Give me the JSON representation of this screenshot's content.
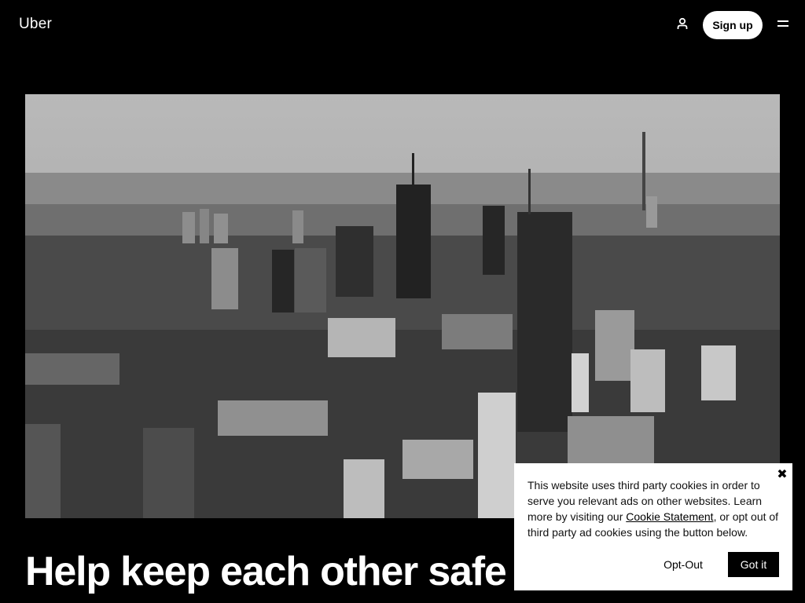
{
  "header": {
    "logo": "Uber",
    "user_icon": "person-icon",
    "signup_label": "Sign up",
    "menu_icon": "hamburger-menu-icon"
  },
  "hero": {
    "image": "black-and-white city skyline"
  },
  "main": {
    "headline": "Help keep each other safe"
  },
  "cookie_banner": {
    "text_before": "This website uses third party cookies in order to serve you relevant ads on other websites. Learn more by visiting our ",
    "link_label": "Cookie Statement",
    "text_after": ", or opt out of third party ad cookies using the button below.",
    "opt_out_label": "Opt-Out",
    "got_it_label": "Got it",
    "close_icon": "close-x-icon"
  }
}
